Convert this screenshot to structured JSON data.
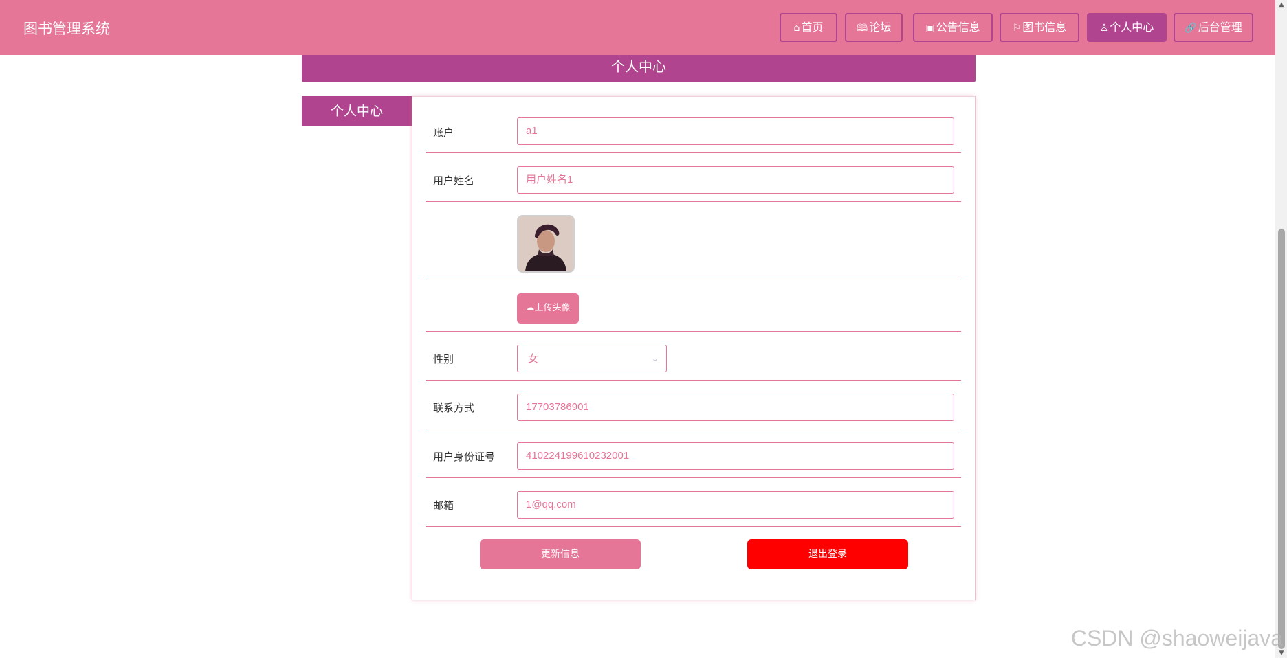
{
  "header": {
    "brand": "图书管理系统",
    "nav": [
      {
        "icon": "home-icon",
        "glyph": "⌂",
        "label": "首页",
        "active": false
      },
      {
        "icon": "book-open-icon",
        "glyph": "🕮",
        "label": "论坛",
        "active": false
      },
      {
        "icon": "gift-icon",
        "glyph": "▣",
        "label": "公告信息",
        "active": false
      },
      {
        "icon": "flag-icon",
        "glyph": "⚐",
        "label": "图书信息",
        "active": false
      },
      {
        "icon": "user-icon",
        "glyph": "♙",
        "label": "个人中心",
        "active": true
      },
      {
        "icon": "link-icon",
        "glyph": "🔗",
        "label": "后台管理",
        "active": false
      }
    ]
  },
  "page": {
    "title": "个人中心",
    "left_tab": "个人中心"
  },
  "form": {
    "account": {
      "label": "账户",
      "value": "a1"
    },
    "username": {
      "label": "用户姓名",
      "value": "用户姓名1"
    },
    "upload_button": "上传头像",
    "gender": {
      "label": "性别",
      "value": "女"
    },
    "phone": {
      "label": "联系方式",
      "value": "17703786901"
    },
    "id_number": {
      "label": "用户身份证号",
      "value": "410224199610232001"
    },
    "email": {
      "label": "邮箱",
      "value": "1@qq.com"
    },
    "update_button": "更新信息",
    "logout_button": "退出登录"
  },
  "watermark": "CSDN @shaoweijava",
  "colors": {
    "primary": "#e57697",
    "accent": "#b0448e",
    "danger": "#ff0000"
  }
}
